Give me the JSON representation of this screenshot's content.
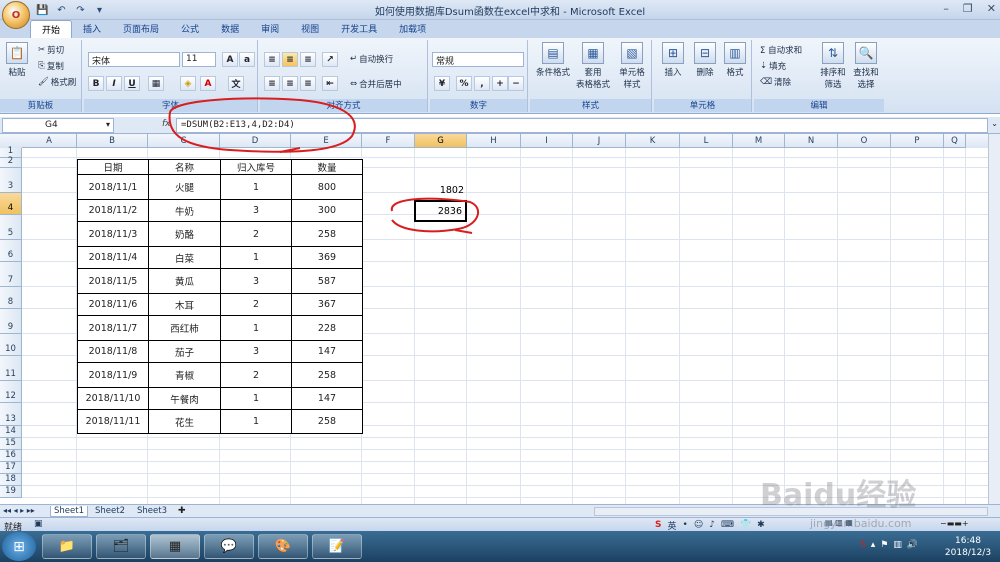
{
  "title": "如何使用数据库Dsum函数在excel中求和 - Microsoft Excel",
  "office_button": "O",
  "tabs": [
    "开始",
    "插入",
    "页面布局",
    "公式",
    "数据",
    "审阅",
    "视图",
    "开发工具",
    "加载项"
  ],
  "ribbon": {
    "clipboard": {
      "paste": "粘贴",
      "cut": "剪切",
      "copy": "复制",
      "format_painter": "格式刷",
      "label": "剪贴板"
    },
    "font": {
      "name": "宋体",
      "size": "11",
      "bold": "B",
      "italic": "I",
      "underline": "U",
      "label": "字体"
    },
    "align": {
      "wrap": "自动换行",
      "merge": "合并后居中",
      "label": "对齐方式"
    },
    "number": {
      "format": "常规",
      "percent": "%",
      "comma": ",",
      "label": "数字"
    },
    "styles": {
      "conditional": "条件格式",
      "table": "套用\n表格格式",
      "cell": "单元格\n样式",
      "label": "样式"
    },
    "cells": {
      "insert": "插入",
      "delete": "删除",
      "format": "格式",
      "label": "单元格"
    },
    "editing": {
      "autosum": "Σ 自动求和",
      "fill": "填充",
      "clear": "清除",
      "sort": "排序和\n筛选",
      "find": "查找和\n选择",
      "label": "编辑"
    }
  },
  "namebox": "G4",
  "fx": "fx",
  "formula": "=DSUM(B2:E13,4,D2:D4)",
  "columns": [
    "A",
    "B",
    "C",
    "D",
    "E",
    "F",
    "G",
    "H",
    "I",
    "J",
    "K",
    "L",
    "M",
    "N",
    "O",
    "P",
    "Q"
  ],
  "rows": [
    "1",
    "2",
    "3",
    "4",
    "5",
    "6",
    "7",
    "8",
    "9",
    "10",
    "11",
    "12",
    "13",
    "14",
    "15",
    "16",
    "17",
    "18",
    "19"
  ],
  "table": {
    "headers": [
      "日期",
      "名称",
      "归入库号",
      "数量"
    ],
    "rows": [
      [
        "2018/11/1",
        "火腿",
        "1",
        "800"
      ],
      [
        "2018/11/2",
        "牛奶",
        "3",
        "300"
      ],
      [
        "2018/11/3",
        "奶酪",
        "2",
        "258"
      ],
      [
        "2018/11/4",
        "白菜",
        "1",
        "369"
      ],
      [
        "2018/11/5",
        "黄瓜",
        "3",
        "587"
      ],
      [
        "2018/11/6",
        "木耳",
        "2",
        "367"
      ],
      [
        "2018/11/7",
        "西红柿",
        "1",
        "228"
      ],
      [
        "2018/11/8",
        "茄子",
        "3",
        "147"
      ],
      [
        "2018/11/9",
        "青椒",
        "2",
        "258"
      ],
      [
        "2018/11/10",
        "午餐肉",
        "1",
        "147"
      ],
      [
        "2018/11/11",
        "花生",
        "1",
        "258"
      ]
    ]
  },
  "g3": "1802",
  "g4": "2836",
  "sheets": [
    "Sheet1",
    "Sheet2",
    "Sheet3"
  ],
  "status": "就绪",
  "ime": "英",
  "watermark": "Baidu经验",
  "watermark_url": "jingyan.baidu.com",
  "clock": {
    "time": "16:48",
    "date": "2018/12/3"
  },
  "accent": "#d81e1e"
}
